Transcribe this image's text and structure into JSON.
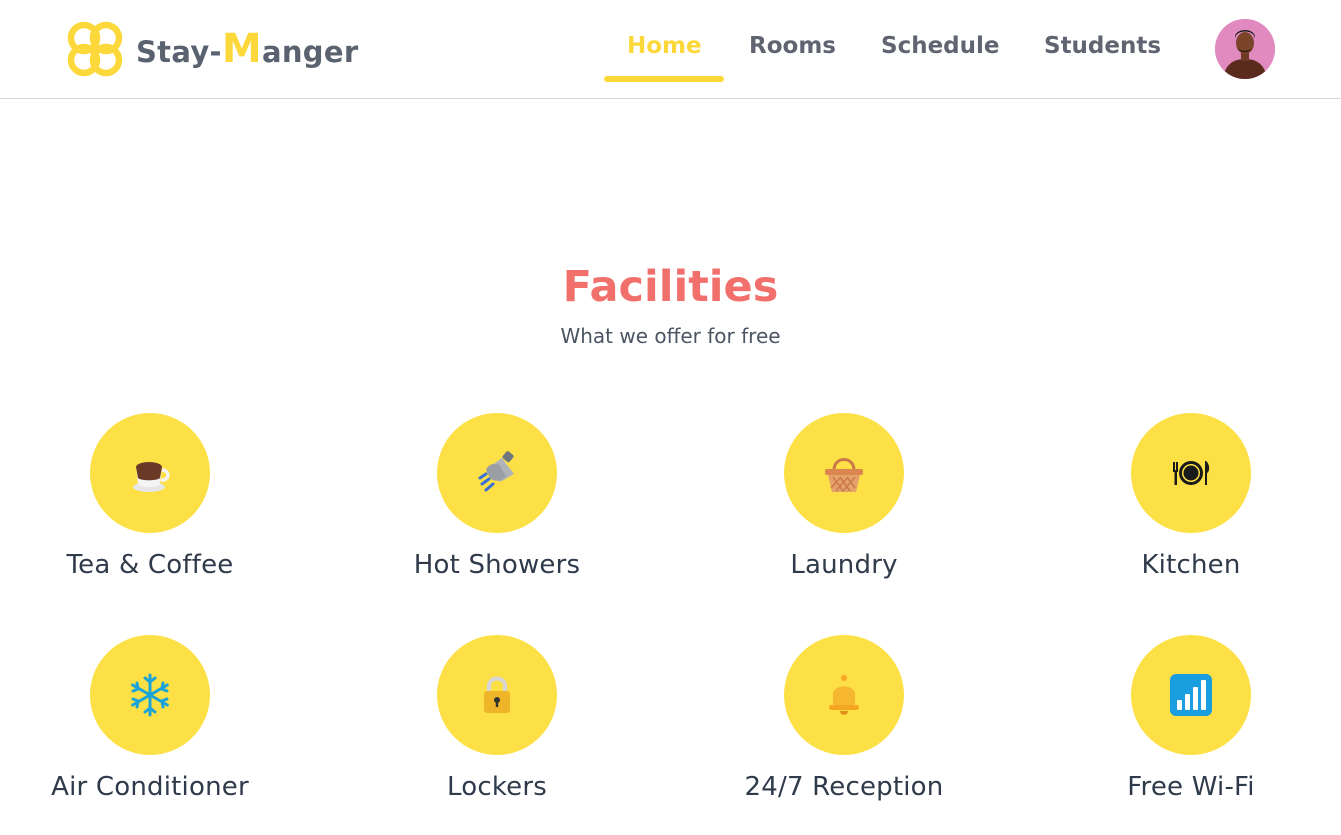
{
  "app": {
    "brand_prefix": "Stay-",
    "brand_initial": "M",
    "brand_suffix": "anger",
    "logo_icon": "four-petal-logo-icon",
    "accent_color": "#fcd83b"
  },
  "nav": {
    "items": [
      {
        "label": "Home",
        "active": true
      },
      {
        "label": "Rooms",
        "active": false
      },
      {
        "label": "Schedule",
        "active": false
      },
      {
        "label": "Students",
        "active": false
      }
    ],
    "avatar_icon": "user-avatar"
  },
  "section": {
    "title": "Facilities",
    "subtitle": "What we offer for free",
    "title_color": "#f2706b"
  },
  "facilities": [
    {
      "label": "Tea & Coffee",
      "icon": "coffee-cup-icon"
    },
    {
      "label": "Hot Showers",
      "icon": "shower-head-icon"
    },
    {
      "label": "Laundry",
      "icon": "laundry-basket-icon"
    },
    {
      "label": "Kitchen",
      "icon": "plate-cutlery-icon"
    },
    {
      "label": "Air Conditioner",
      "icon": "snowflake-icon"
    },
    {
      "label": "Lockers",
      "icon": "padlock-icon"
    },
    {
      "label": "24/7 Reception",
      "icon": "reception-bell-icon"
    },
    {
      "label": "Free Wi-Fi",
      "icon": "signal-bars-icon"
    }
  ]
}
